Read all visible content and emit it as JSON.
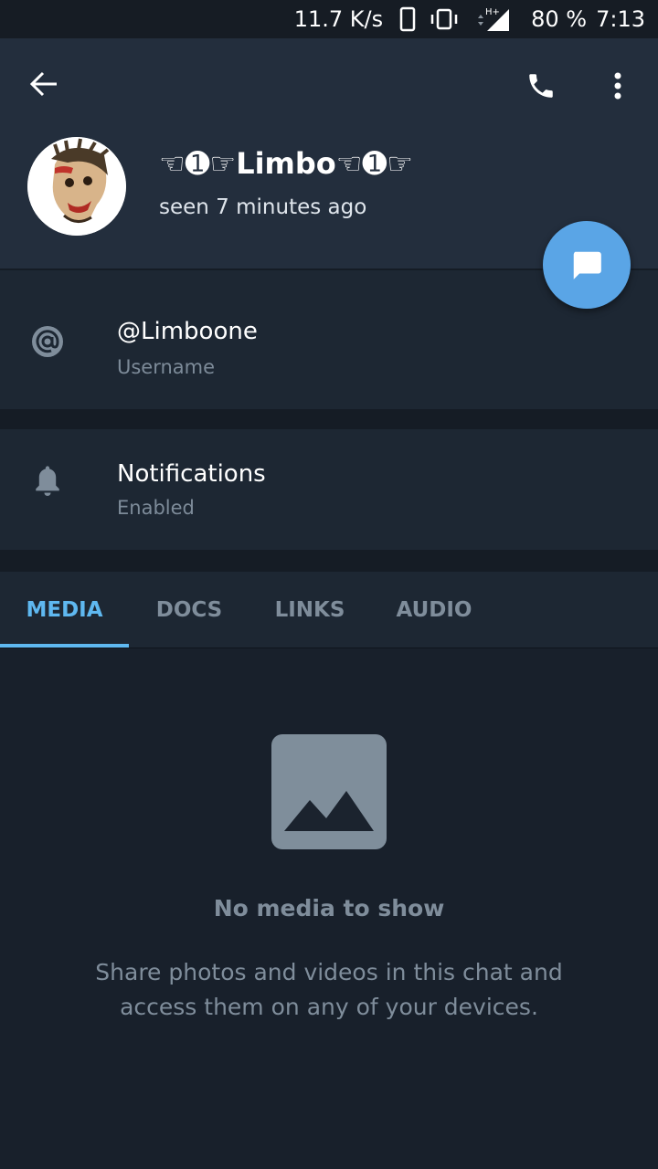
{
  "status_bar": {
    "net_speed": "11.7 K/s",
    "network_type": "H+",
    "battery": "80 %",
    "time": "7:13"
  },
  "profile": {
    "name": "☜➊☞Limbo☜➊☞",
    "status": "seen 7 minutes ago"
  },
  "username_row": {
    "value": "@Limboone",
    "label": "Username",
    "icon": "at-sign-icon"
  },
  "notifications_row": {
    "value": "Notifications",
    "label": "Enabled",
    "icon": "bell-icon"
  },
  "tabs": [
    {
      "label": "MEDIA",
      "active": true
    },
    {
      "label": "DOCS",
      "active": false
    },
    {
      "label": "LINKS",
      "active": false
    },
    {
      "label": "AUDIO",
      "active": false
    }
  ],
  "empty_state": {
    "title": "No media to show",
    "description": "Share photos and videos in this chat and access them on any of your devices."
  },
  "colors": {
    "accent": "#5fb8f0",
    "fab": "#5aa5e6",
    "header": "#232e3d",
    "row": "#1d2733",
    "background": "#18202b"
  }
}
